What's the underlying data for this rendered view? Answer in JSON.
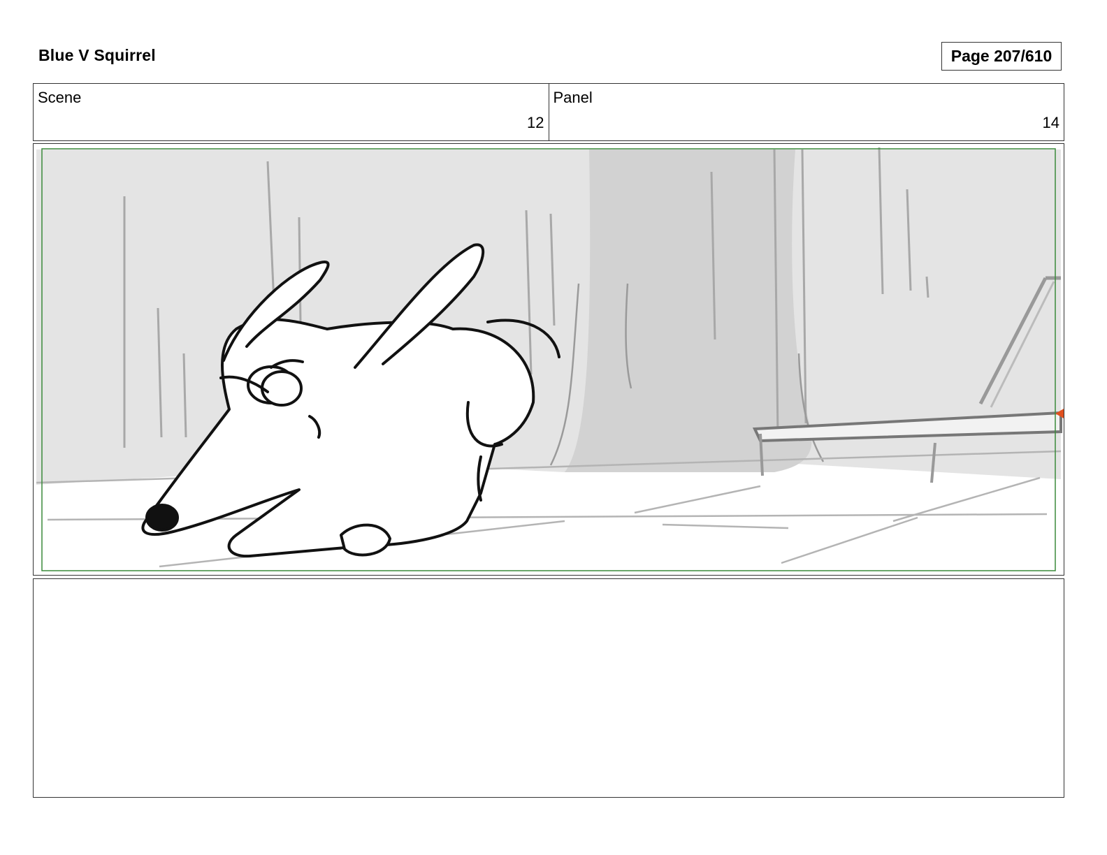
{
  "header": {
    "project_title": "Blue V Squirrel",
    "page_label": "Page 207/610"
  },
  "info": {
    "scene_label": "Scene",
    "scene_value": "12",
    "panel_label": "Panel",
    "panel_value": "14"
  },
  "colors": {
    "safe_frame": "#3a8a3a",
    "marker": "#e0501e",
    "background_wash": "#e2e2e2"
  }
}
